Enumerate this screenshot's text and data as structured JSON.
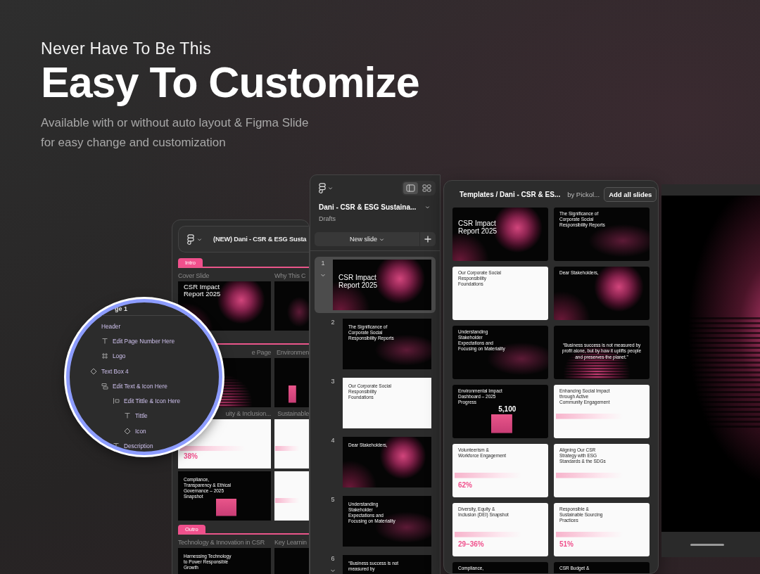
{
  "headline": {
    "kicker": "Never Have To Be This",
    "title": "Easy To Customize",
    "subtitle_lines": [
      "Available with or without auto layout  & Figma Slide",
      "for easy change and customization"
    ]
  },
  "outline_window": {
    "title": "(NEW) Dani - CSR & ESG Susta",
    "sections": [
      {
        "tag": "Intro",
        "cards": [
          {
            "label": "Cover Slide",
            "slide": {
              "kind": "cover",
              "title": "CSR Impact Report 2025"
            }
          },
          {
            "label": "Why This C",
            "slide": {
              "kind": "dark-glow"
            }
          }
        ]
      },
      {
        "cards": [
          {
            "label": "e Page",
            "slide": {
              "kind": "quote"
            }
          },
          {
            "label": "Environmen",
            "slide": {
              "kind": "dark-chart"
            }
          },
          {
            "label": "uity & Inclusion...",
            "slide": {
              "kind": "light-chart",
              "figure": "38%"
            }
          },
          {
            "label": "Sustainable",
            "slide": {
              "kind": "light-chart"
            }
          },
          {
            "slide": {
              "kind": "dark-chart",
              "title": "Compliance, Transparency & Ethical Governance – 2025 Snapshot"
            }
          },
          {
            "slide": {
              "kind": "light-chart"
            }
          }
        ]
      },
      {
        "tag": "Outro",
        "cards": [
          {
            "label": "Technology & Innovation in CSR",
            "slide": {
              "kind": "dark-plain",
              "title": "Harnessing Technology to Power Responsible Growth"
            }
          },
          {
            "label": "Key Learnin",
            "slide": {
              "kind": "dark-plain"
            }
          }
        ]
      }
    ]
  },
  "layers_magnifier": {
    "page_title": "ge 1",
    "layers": [
      {
        "name": "Header",
        "kind": "group",
        "children": [
          {
            "name": "Edit Page Number Here",
            "kind": "text"
          },
          {
            "name": "Logo",
            "kind": "frame"
          }
        ]
      },
      {
        "name": "Text Box 4",
        "kind": "component",
        "children": [
          {
            "name": "Edit Text & Icon Here",
            "kind": "stack",
            "children": [
              {
                "name": "Edit Tittle & Icon Here",
                "kind": "row",
                "children": [
                  {
                    "name": "Tittle",
                    "kind": "text"
                  },
                  {
                    "name": "Icon",
                    "kind": "component"
                  }
                ]
              },
              {
                "name": "Description",
                "kind": "text"
              }
            ]
          }
        ]
      }
    ]
  },
  "slides_window": {
    "title": "Dani - CSR & ESG Sustaina...",
    "location": "Drafts",
    "view_toggles": [
      {
        "kind": "list",
        "selected": true
      },
      {
        "kind": "grid",
        "selected": false
      }
    ],
    "new_slide_button": "New slide",
    "slides": [
      {
        "number": "1",
        "selected": true,
        "group": true,
        "slide": {
          "kind": "cover",
          "title": "CSR Impact Report 2025"
        }
      },
      {
        "number": "2",
        "selected": false,
        "group": false,
        "slide": {
          "kind": "dark-glow",
          "title": "The Significance of Corporate Social Responsibility Reports"
        }
      },
      {
        "number": "3",
        "selected": false,
        "group": false,
        "slide": {
          "kind": "light",
          "title": "Our Corporate Social Responsibility Foundations"
        }
      },
      {
        "number": "4",
        "selected": false,
        "group": false,
        "slide": {
          "kind": "dark-sphere",
          "title": "Dear Stakeholders,"
        }
      },
      {
        "number": "5",
        "selected": false,
        "group": false,
        "slide": {
          "kind": "dark-glow",
          "title": "Understanding Stakeholder Expectations and Focusing on Materiality"
        }
      },
      {
        "number": "6",
        "selected": false,
        "group": true,
        "slide": {
          "kind": "dark-plain",
          "title": "“Business success is not measured by"
        }
      }
    ]
  },
  "templates_window": {
    "breadcrumb": "Templates / Dani - CSR & ES...",
    "author": "by Pickol...",
    "add_button": "Add all slides",
    "slides": [
      {
        "kind": "cover",
        "title": "CSR Impact Report 2025"
      },
      {
        "kind": "dark-glow",
        "title": "The Significance of Corporate Social Responsibility Reports"
      },
      {
        "kind": "light",
        "title": "Our Corporate Social Responsibility Foundations"
      },
      {
        "kind": "dark-sphere",
        "title": "Dear Stakeholders,"
      },
      {
        "kind": "dark-glow",
        "title": "Understanding Stakeholder Expectations and Focusing on Materiality"
      },
      {
        "kind": "quote",
        "title": "“Business success is not measured by profit alone, but by how it uplifts people and preserves the planet.”"
      },
      {
        "kind": "dark-chart",
        "title": "Environmental Impact Dashboard – 2025 Progress",
        "figure": "5,100"
      },
      {
        "kind": "light-chart",
        "title": "Enhancing Social Impact through Active Community Engagement"
      },
      {
        "kind": "light-chart",
        "title": "Volunteerism & Workforce Engagement",
        "figure": "62%"
      },
      {
        "kind": "light-chart",
        "title": "Aligning Our CSR Strategy with ESG Standards & the SDGs"
      },
      {
        "kind": "light-chart",
        "title": "Diversity, Equity & Inclusion (DEI) Snapshot",
        "figure": "29–36%"
      },
      {
        "kind": "light-chart",
        "title": "Responsible & Sustainable Sourcing Practices",
        "figure": "51%"
      },
      {
        "kind": "dark-plain",
        "title": "Compliance,"
      },
      {
        "kind": "dark-plain",
        "title": "CSR Budget &"
      }
    ]
  }
}
